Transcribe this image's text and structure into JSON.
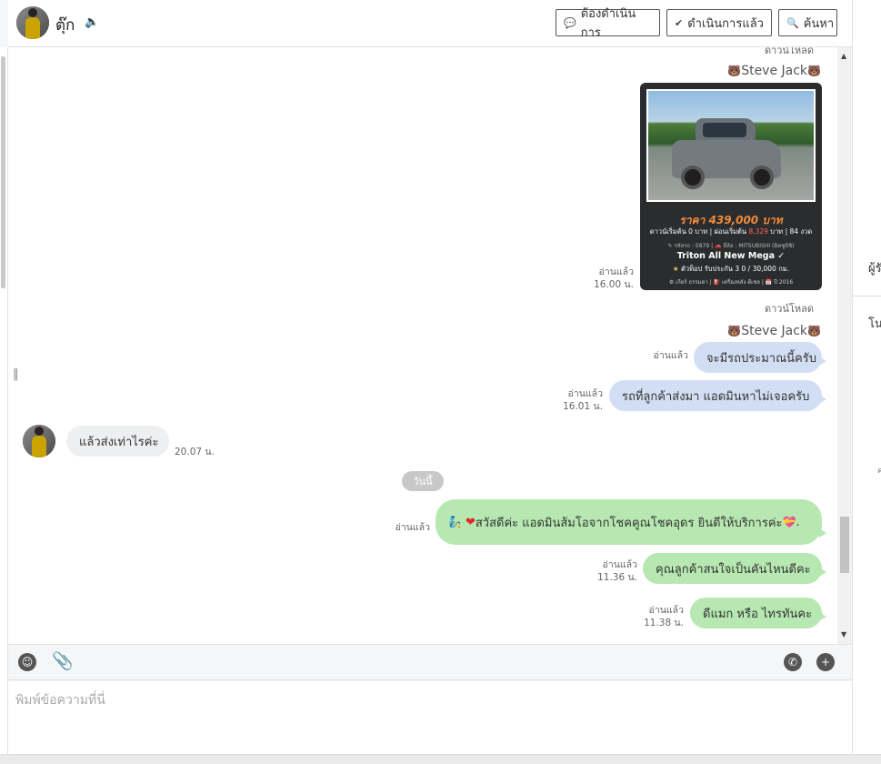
{
  "header": {
    "contact_name": "ตุ๊ก",
    "btn_todo": "ต้องดำเนินการ",
    "btn_done": "ดำเนินการแล้ว",
    "btn_search": "ค้นหา"
  },
  "chat": {
    "top_download_cut": "ดาวน์โหลด",
    "sender_name": "Steve Jack",
    "image_read": "อ่านแล้ว",
    "image_time": "16.00 น.",
    "card": {
      "price": "ราคา 439,000 บาท",
      "line1_a": "ดาวน์เริ่มต้น 0 บาท | ผ่อนเริ่มต้น ",
      "line1_hi": "8,329",
      "line1_b": " บาท | 84 งวด",
      "line2": "✎ รหัสรถ : E879 | 🚗 ยี่ห้อ : MITSUBISHI (มิตซูบิชิ)",
      "line3": "Triton All New Mega ✓",
      "line4_star": "★",
      "line4": " ตัวท็อป รับประกัน 3 0 / 30,000 กม.",
      "line5": "⚙ เกียร์ ธรรมดา | ⛽ เครื่องหลัง ดีเซล | 📅 ปี 2016"
    },
    "download": "ดาวน์โหลด",
    "msg1": "จะมีรถประมาณนี้ครับ",
    "msg1_read": "อ่านแล้ว",
    "msg2": "รถที่ลูกค้าส่งมา แอดมินหาไม่เจอครับ",
    "msg2_read": "อ่านแล้ว",
    "msg2_time": "16.01 น.",
    "incoming": "แล้วส่งเท่าไรค่ะ",
    "incoming_time": "20.07 น.",
    "date_divider": "วันนี้",
    "msg3_emoji1": "🧞",
    "msg3_heart": "❤",
    "msg3": " สวัสดีค่ะ แอดมินส้มโอจากโชคคูณโชคอุดร ยินดีให้บริการค่ะ ",
    "msg3_emoji2": "💝",
    "msg3_end": ".",
    "msg3_read": "อ่านแล้ว",
    "msg4": "คุณลูกค้าสนใจเป็นคันไหนดีคะ",
    "msg4_read": "อ่านแล้ว",
    "msg4_time": "11.36 น.",
    "msg5": "ดีแมก หรือ ไทรทันคะ",
    "msg5_read": "อ่านแล้ว",
    "msg5_time": "11.38 น."
  },
  "input": {
    "placeholder": "พิมพ์ข้อความที่นี่"
  },
  "right_panel": {
    "label_top": "ผู้รั",
    "label_mid": "โน",
    "label_small": "ค"
  }
}
